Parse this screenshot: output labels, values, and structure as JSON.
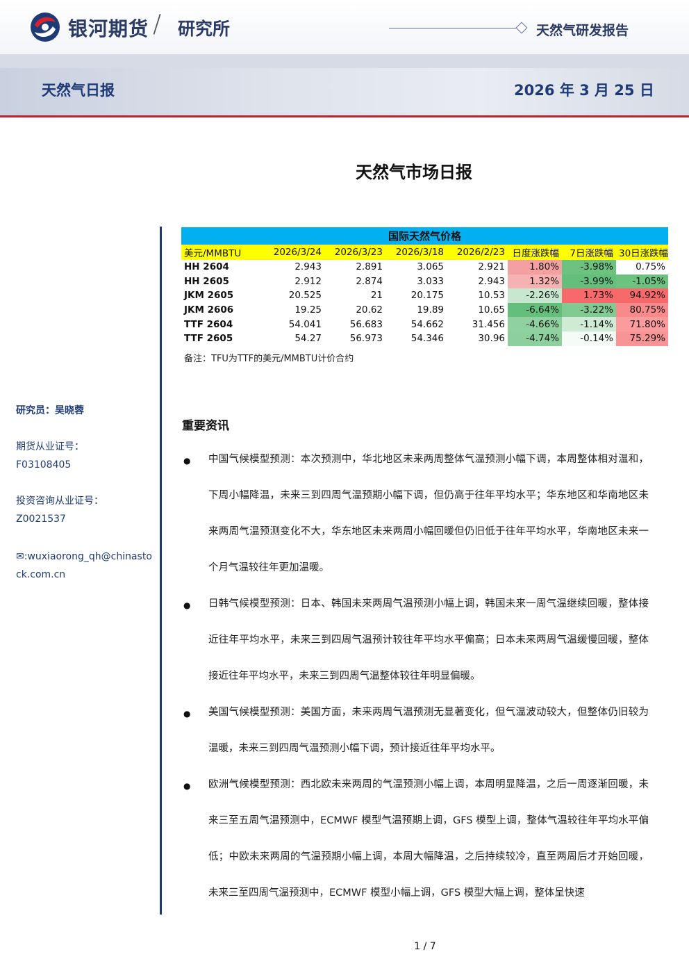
{
  "header": {
    "brand": "银河期货",
    "slash": "/",
    "dept": "研究所",
    "report_type": "天然气研发报告"
  },
  "band": {
    "left": "天然气日报",
    "date": "2026 年 3 月 25 日"
  },
  "title": "天然气市场日报",
  "sidebar": {
    "researcher": "研究员：吴晓蓉",
    "license_label": "期货从业证号：",
    "license_value": "F03108405",
    "consult_label": "投资咨询从业证号：",
    "consult_value": "Z0021537",
    "email": "✉:wuxiaorong_qh@chinastock.com.cn"
  },
  "table": {
    "title": "国际天然气价格",
    "headers": [
      "美元/MMBTU",
      "2026/3/24",
      "2026/3/23",
      "2026/3/18",
      "2026/2/23",
      "日度涨跌幅",
      "7日涨跌幅",
      "30日涨跌幅"
    ],
    "rows": [
      {
        "name": "HH 2604",
        "v1": "2.943",
        "v2": "2.891",
        "v3": "3.065",
        "v4": "2.921",
        "d": "1.80%",
        "w": "-3.98%",
        "m": "0.75%",
        "dc": "#f4a0a0",
        "wc": "#6cc380",
        "mc": "#ffffff"
      },
      {
        "name": "HH 2605",
        "v1": "2.912",
        "v2": "2.874",
        "v3": "3.033",
        "v4": "2.943",
        "d": "1.32%",
        "w": "-3.99%",
        "m": "-1.05%",
        "dc": "#f6b2b2",
        "wc": "#63bf7b",
        "mc": "#6cc380"
      },
      {
        "name": "JKM 2605",
        "v1": "20.525",
        "v2": "21",
        "v3": "20.175",
        "v4": "10.53",
        "d": "-2.26%",
        "w": "1.73%",
        "m": "94.92%",
        "dc": "#c7e8cf",
        "wc": "#f8696b",
        "mc": "#f8696b"
      },
      {
        "name": "JKM 2606",
        "v1": "19.25",
        "v2": "20.62",
        "v3": "19.89",
        "v4": "10.65",
        "d": "-6.64%",
        "w": "-3.22%",
        "m": "80.75%",
        "dc": "#63bf7b",
        "wc": "#7fcb91",
        "mc": "#f98a8c"
      },
      {
        "name": "TTF 2604",
        "v1": "54.041",
        "v2": "56.683",
        "v3": "54.662",
        "v4": "31.456",
        "d": "-4.66%",
        "w": "-1.14%",
        "m": "71.80%",
        "dc": "#8fd19f",
        "wc": "#cfebd6",
        "mc": "#fa9c9e"
      },
      {
        "name": "TTF 2605",
        "v1": "54.27",
        "v2": "56.973",
        "v3": "54.346",
        "v4": "30.96",
        "d": "-4.74%",
        "w": "-0.14%",
        "m": "75.29%",
        "dc": "#8dd09d",
        "wc": "#f5fbf6",
        "mc": "#f99496"
      }
    ],
    "note": "备注：TFU为TTF的美元/MMBTU计价合约"
  },
  "section_title": "重要资讯",
  "bullets": [
    "中国气候模型预测：本次预测中，华北地区未来两周整体气温预测小幅下调，本周整体相对温和，下周小幅降温，未来三到四周气温预期小幅下调，但仍高于往年平均水平；华东地区和华南地区未来两周气温预测变化不大，华东地区未来两周小幅回暖但仍旧低于往年平均水平，华南地区未来一个月气温较往年更加温暖。",
    "日韩气候模型预测：日本、韩国未来两周气温预测小幅上调，韩国未来一周气温继续回暖，整体接近往年平均水平，未来三到四周气温预计较往年平均水平偏高；日本未来两周气温缓慢回暖，整体接近往年平均水平，未来三到四周气温整体较往年明显偏暖。",
    "美国气候模型预测：美国方面，未来两周气温预测无显著变化，但气温波动较大，但整体仍旧较为温暖，未来三到四周气温预测小幅下调，预计接近往年平均水平。",
    "欧洲气候模型预测：西北欧未来两周的气温预测小幅上调，本周明显降温，之后一周逐渐回暖，未来三至五周气温预测中，ECMWF 模型气温预期上调，GFS 模型上调，整体气温较往年平均水平偏低；中欧未来两周的气温预期小幅上调，本周大幅降温，之后持续较冷，直至两周后才开始回暖，未来三至四周气温预测中，ECMWF 模型小幅上调，GFS 模型大幅上调，整体呈快速"
  ],
  "footer": "1 / 7",
  "colors": {
    "navy": "#1f3b77",
    "table_title_bg": "#00b0f0",
    "header_bg": "#ffff00",
    "red_line": "#c42026"
  }
}
